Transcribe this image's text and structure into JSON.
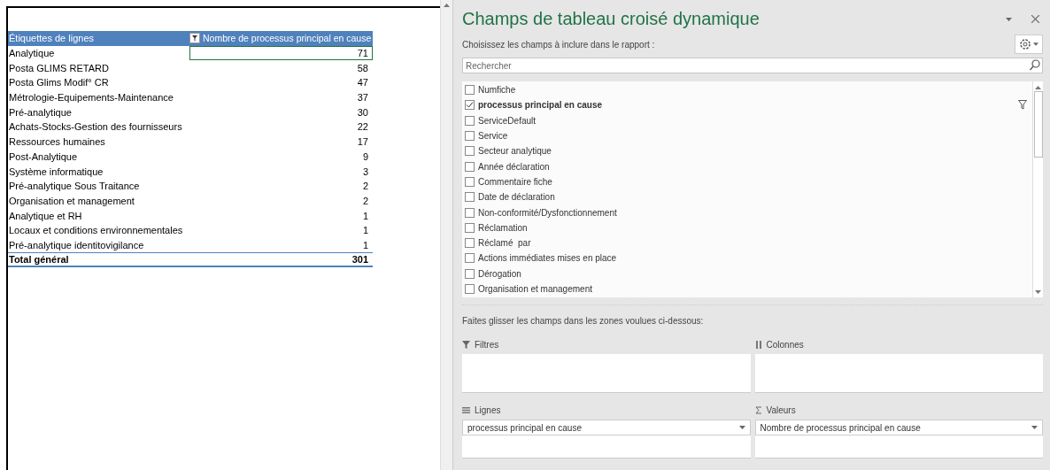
{
  "pivot_table": {
    "columns": [
      "Étiquettes de lignes",
      "Nombre de processus principal en cause"
    ],
    "rows": [
      {
        "label": "Analytique",
        "value": "71",
        "selected": true
      },
      {
        "label": "Posta GLIMS RETARD",
        "value": "58",
        "selected": false
      },
      {
        "label": "Posta Glims Modif° CR",
        "value": "47",
        "selected": false
      },
      {
        "label": "Métrologie-Equipements-Maintenance",
        "value": "37",
        "selected": false
      },
      {
        "label": "Pré-analytique",
        "value": "30",
        "selected": false
      },
      {
        "label": "Achats-Stocks-Gestion des fournisseurs",
        "value": "22",
        "selected": false
      },
      {
        "label": "Ressources humaines",
        "value": "17",
        "selected": false
      },
      {
        "label": "Post-Analytique",
        "value": "9",
        "selected": false
      },
      {
        "label": "Système informatique",
        "value": "3",
        "selected": false
      },
      {
        "label": "Pré-analytique Sous Traitance",
        "value": "2",
        "selected": false
      },
      {
        "label": "Organisation et management",
        "value": "2",
        "selected": false
      },
      {
        "label": "Analytique et RH",
        "value": "1",
        "selected": false
      },
      {
        "label": "Locaux et conditions environnementales",
        "value": "1",
        "selected": false
      },
      {
        "label": "Pré-analytique identitovigilance",
        "value": "1",
        "selected": false
      }
    ],
    "total": {
      "label": "Total général",
      "value": "301"
    }
  },
  "panel": {
    "title": "Champs de tableau croisé dynamique",
    "subtitle": "Choisissez les champs à inclure dans le rapport :",
    "search": {
      "placeholder": "Rechercher"
    },
    "fields": [
      {
        "label": "Numfiche",
        "checked": false
      },
      {
        "label": "processus principal en cause",
        "checked": true
      },
      {
        "label": "ServiceDefault",
        "checked": false
      },
      {
        "label": "Service",
        "checked": false
      },
      {
        "label": "Secteur analytique",
        "checked": false
      },
      {
        "label": "Année déclaration",
        "checked": false
      },
      {
        "label": "Commentaire fiche",
        "checked": false
      },
      {
        "label": "Date de déclaration",
        "checked": false
      },
      {
        "label": "Non-conformité/Dysfonctionnement",
        "checked": false
      },
      {
        "label": "Réclamation",
        "checked": false
      },
      {
        "label": "Réclamé  par",
        "checked": false
      },
      {
        "label": "Actions immédiates mises en place",
        "checked": false
      },
      {
        "label": "Dérogation",
        "checked": false
      },
      {
        "label": "Organisation et management",
        "checked": false
      }
    ],
    "drag_hint": "Faites glisser les champs dans les zones voulues ci-dessous:",
    "areas": [
      {
        "kind": "filter",
        "label": "Filtres"
      },
      {
        "kind": "columns",
        "label": "Colonnes"
      },
      {
        "kind": "rows",
        "label": "Lignes",
        "items": [
          "processus principal en cause"
        ]
      },
      {
        "kind": "values",
        "label": "Valeurs",
        "items": [
          "Nombre de processus principal en cause"
        ]
      }
    ]
  }
}
